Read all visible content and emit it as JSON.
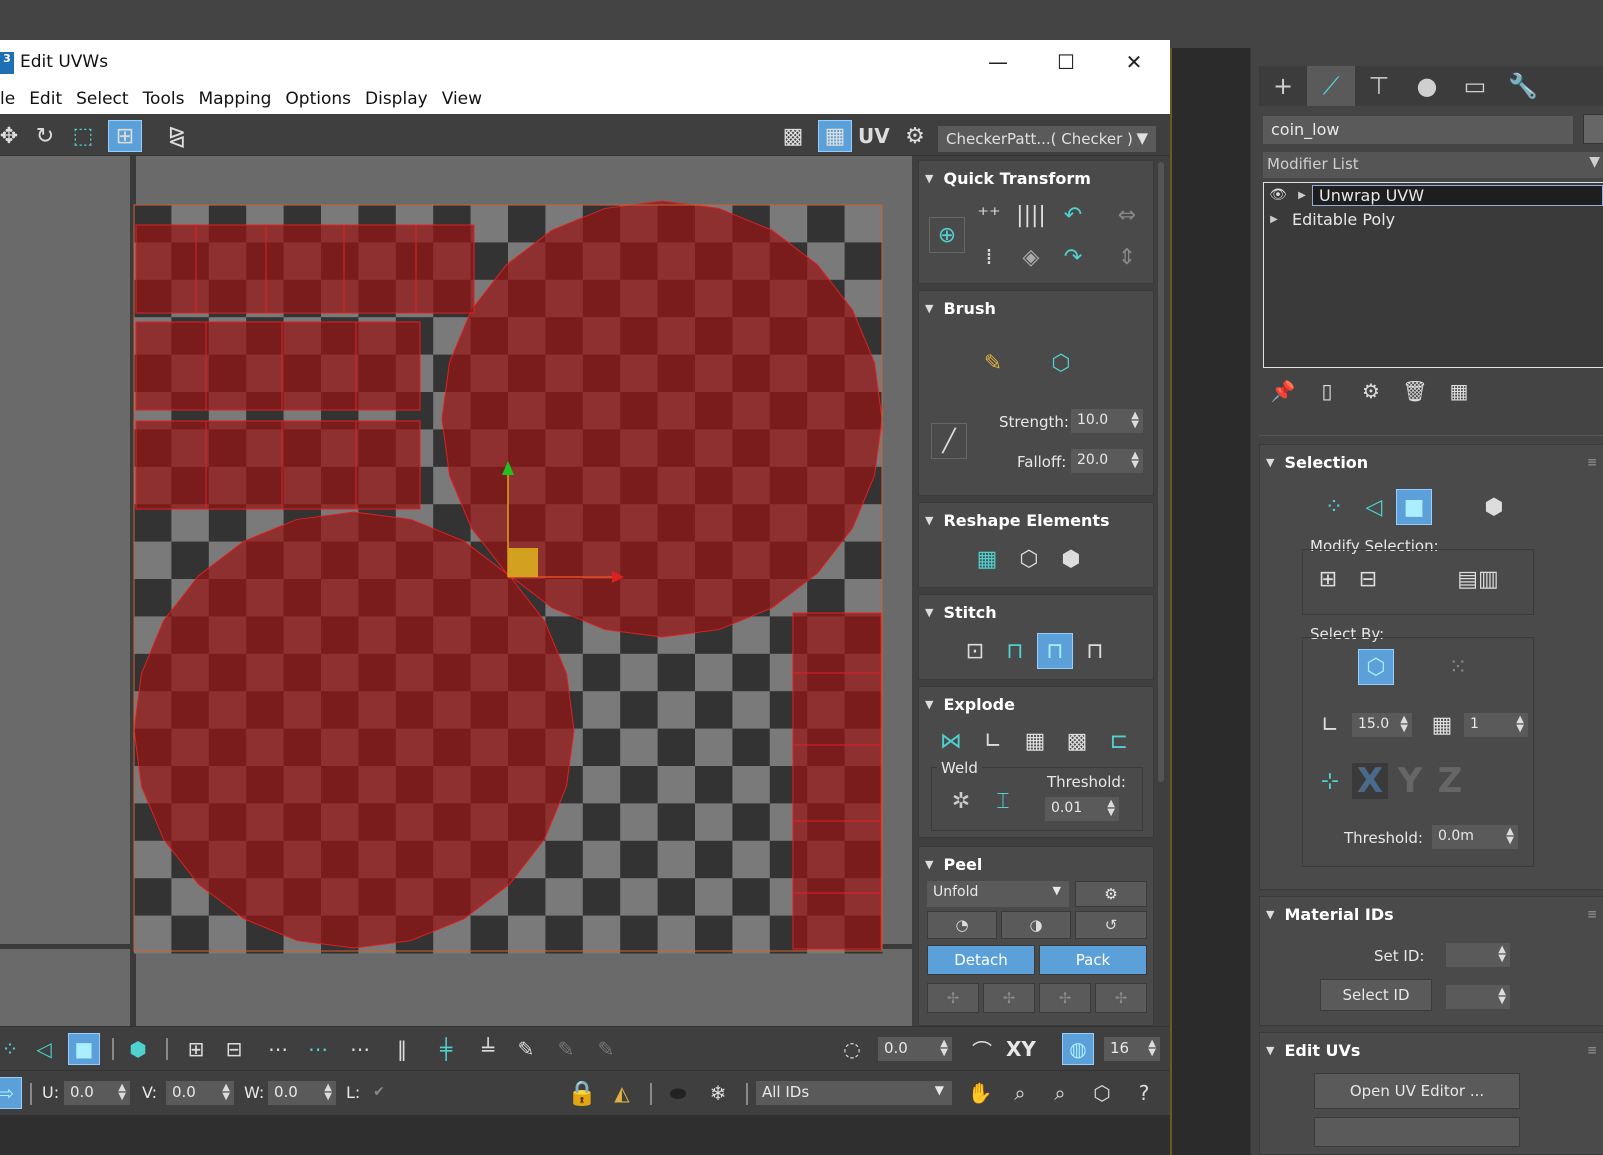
{
  "window": {
    "title": "Edit UVWs",
    "app_icon": "3",
    "controls": {
      "minimize": "—",
      "maximize": "☐",
      "close": "✕"
    }
  },
  "menu": [
    "le",
    "Edit",
    "Select",
    "Tools",
    "Mapping",
    "Options",
    "Display",
    "View"
  ],
  "toolbar": {
    "uv_label": "UV",
    "checker_pattern": "CheckerPatt...( Checker )"
  },
  "quick_transform": {
    "title": "Quick Transform"
  },
  "brush": {
    "title": "Brush",
    "strength_label": "Strength:",
    "strength_value": "10.0",
    "falloff_label": "Falloff:",
    "falloff_value": "20.0"
  },
  "reshape": {
    "title": "Reshape Elements"
  },
  "stitch": {
    "title": "Stitch"
  },
  "explode": {
    "title": "Explode",
    "weld_label": "Weld",
    "threshold_label": "Threshold:",
    "threshold_value": "0.01"
  },
  "peel": {
    "title": "Peel",
    "mode": "Unfold",
    "detach_label": "Detach",
    "pack_label": "Pack"
  },
  "bottom": {
    "rotate_value": "0.0",
    "xy_label": "XY",
    "grid_value": "16",
    "u_label": "U:",
    "u_value": "0.0",
    "v_label": "V:",
    "v_value": "0.0",
    "w_label": "W:",
    "w_value": "0.0",
    "l_label": "L:",
    "ids_value": "All IDs"
  },
  "command_panel": {
    "object_name": "coin_low",
    "modifier_list": "Modifier List",
    "stack": [
      "Unwrap UVW",
      "Editable Poly"
    ],
    "selection": {
      "title": "Selection",
      "modify_selection_label": "Modify Selection:",
      "select_by_label": "Select By:",
      "angle_value": "15.0",
      "count_value": "1",
      "threshold_label": "Threshold:",
      "threshold_value": "0.0m",
      "x_label": "X",
      "y_label": "Y",
      "z_label": "Z"
    },
    "material_ids": {
      "title": "Material IDs",
      "set_id_label": "Set ID:",
      "select_id_label": "Select ID"
    },
    "edit_uvs": {
      "title": "Edit UVs",
      "open_editor_label": "Open UV Editor ..."
    }
  },
  "colors": {
    "accent_cyan": "#4fd1d0",
    "active_blue": "#5ba0d8",
    "uv_selection_red": "#8b1a1a"
  }
}
